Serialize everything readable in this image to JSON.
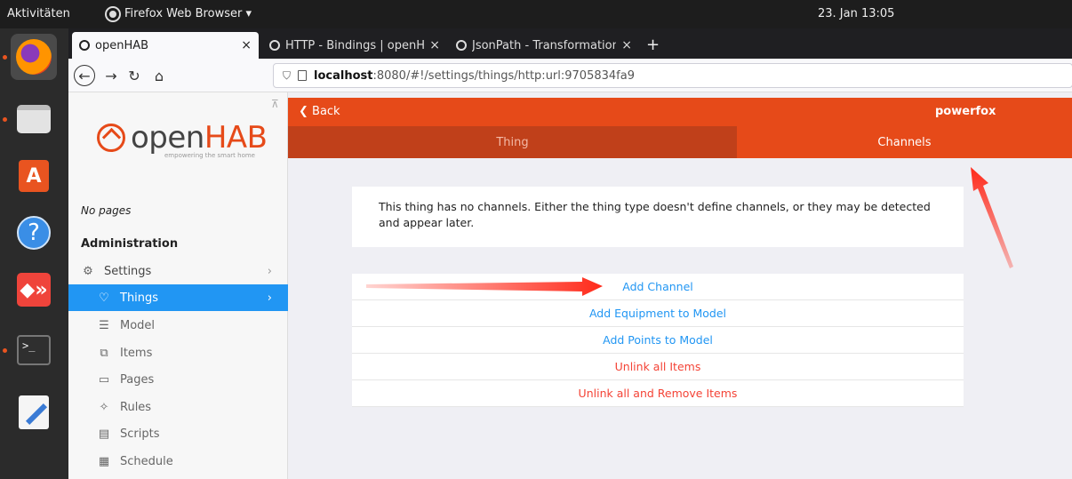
{
  "topbar": {
    "activities": "Aktivitäten",
    "app_name": "Firefox Web Browser ▾",
    "clock": "23. Jan  13:05"
  },
  "dock": {
    "apps": [
      "firefox-icon",
      "files-icon",
      "software-icon",
      "help-icon",
      "anydesk-icon",
      "terminal-icon",
      "text-editor-icon"
    ]
  },
  "browser": {
    "tabs": [
      {
        "label": "openHAB",
        "close": "×"
      },
      {
        "label": "HTTP - Bindings | openHAB",
        "close": "×"
      },
      {
        "label": "JsonPath - Transformations",
        "close": "×"
      }
    ],
    "new_tab": "+",
    "url_host": "localhost",
    "url_path": ":8080/#!/settings/things/http:url:9705834fa9"
  },
  "sidebar": {
    "logo_open": "open",
    "logo_hab": "HAB",
    "logo_tag": "empowering the smart home",
    "no_pages": "No pages",
    "admin_heading": "Administration",
    "items": [
      {
        "label": "Settings",
        "icon": "⚙"
      },
      {
        "label": "Things",
        "icon": "♡"
      },
      {
        "label": "Model",
        "icon": "☰"
      },
      {
        "label": "Items",
        "icon": "⧉"
      },
      {
        "label": "Pages",
        "icon": "▭"
      },
      {
        "label": "Rules",
        "icon": "✧"
      },
      {
        "label": "Scripts",
        "icon": "▤"
      },
      {
        "label": "Schedule",
        "icon": "▦"
      }
    ]
  },
  "main": {
    "back_label": "❮ Back",
    "title": "powerfox",
    "tab_thing": "Thing",
    "tab_channels": "Channels",
    "no_channels_msg": "This thing has no channels. Either the thing type doesn't define channels, or they may be detected and appear later.",
    "actions": {
      "add_channel": "Add Channel",
      "add_equipment": "Add Equipment to Model",
      "add_points": "Add Points to Model",
      "unlink_all": "Unlink all Items",
      "unlink_remove": "Unlink all and Remove Items"
    }
  },
  "colors": {
    "accent": "#e64a19",
    "primary_link": "#2196f3",
    "danger": "#f44336",
    "annotation_arrow": "#ff2a1a"
  }
}
